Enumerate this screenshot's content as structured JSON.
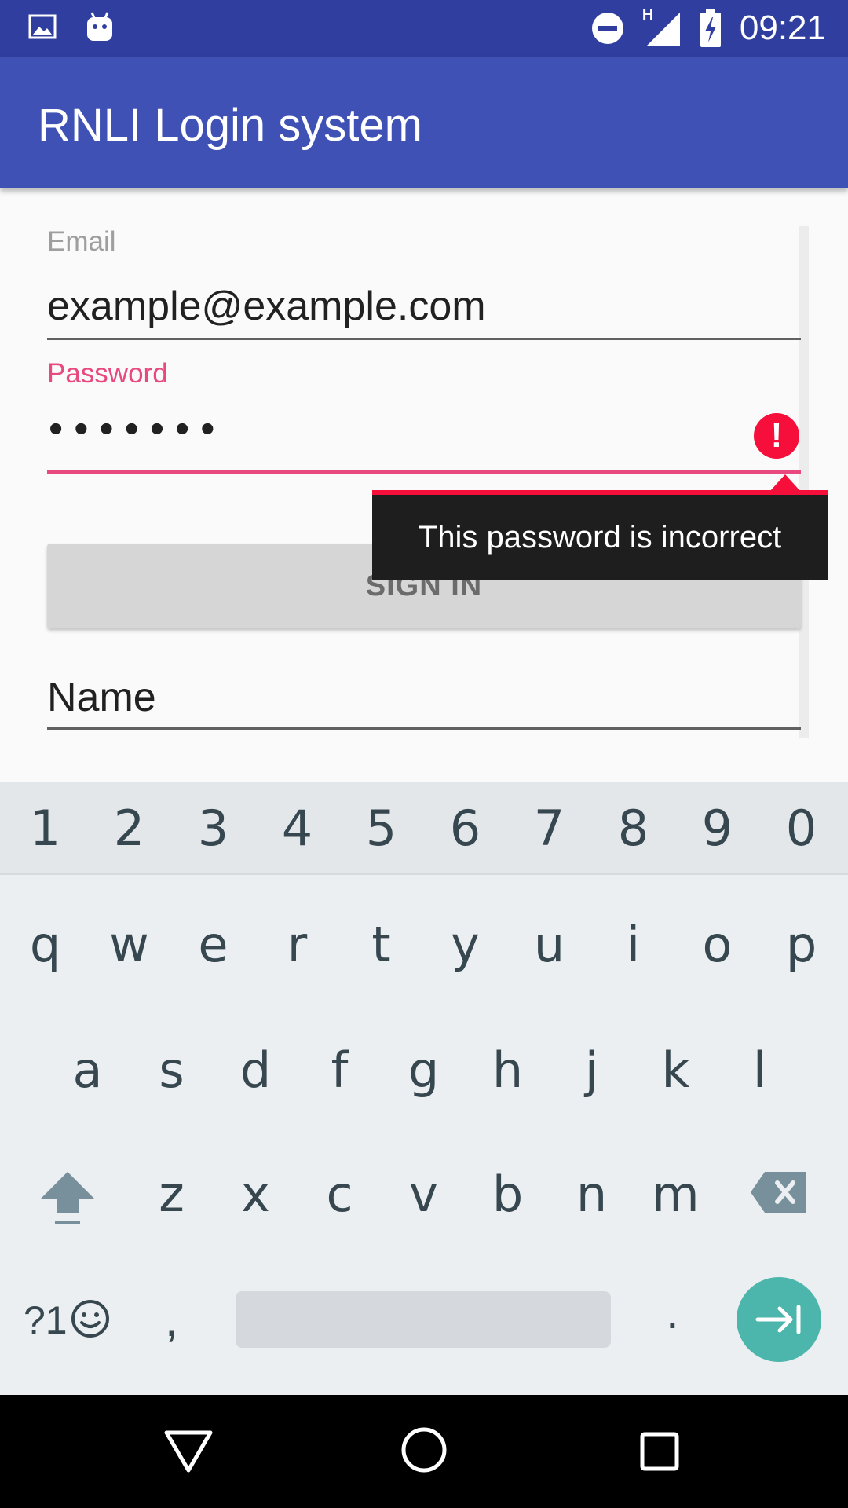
{
  "status_bar": {
    "time": "09:21",
    "network_type": "H",
    "icons": [
      "image-icon",
      "android-icon",
      "do-not-disturb-icon",
      "signal-icon",
      "battery-charging-icon"
    ]
  },
  "app_bar": {
    "title": "RNLI Login system"
  },
  "form": {
    "email": {
      "label": "Email",
      "value": "example@example.com"
    },
    "password": {
      "label": "Password",
      "value_masked": "•••••••",
      "error_message": "This password is incorrect"
    },
    "sign_in_label": "SIGN IN",
    "name": {
      "value": "Name"
    }
  },
  "keyboard": {
    "number_row": [
      "1",
      "2",
      "3",
      "4",
      "5",
      "6",
      "7",
      "8",
      "9",
      "0"
    ],
    "row1": [
      "q",
      "w",
      "e",
      "r",
      "t",
      "y",
      "u",
      "i",
      "o",
      "p"
    ],
    "row2": [
      "a",
      "s",
      "d",
      "f",
      "g",
      "h",
      "j",
      "k",
      "l"
    ],
    "row3": [
      "z",
      "x",
      "c",
      "v",
      "b",
      "n",
      "m"
    ],
    "symbols_label": "?1",
    "comma": ",",
    "period": "."
  },
  "colors": {
    "status_bar": "#303f9f",
    "app_bar": "#3f51b5",
    "accent": "#e8497e",
    "error": "#f50f3a",
    "action_key": "#4db6ac"
  }
}
